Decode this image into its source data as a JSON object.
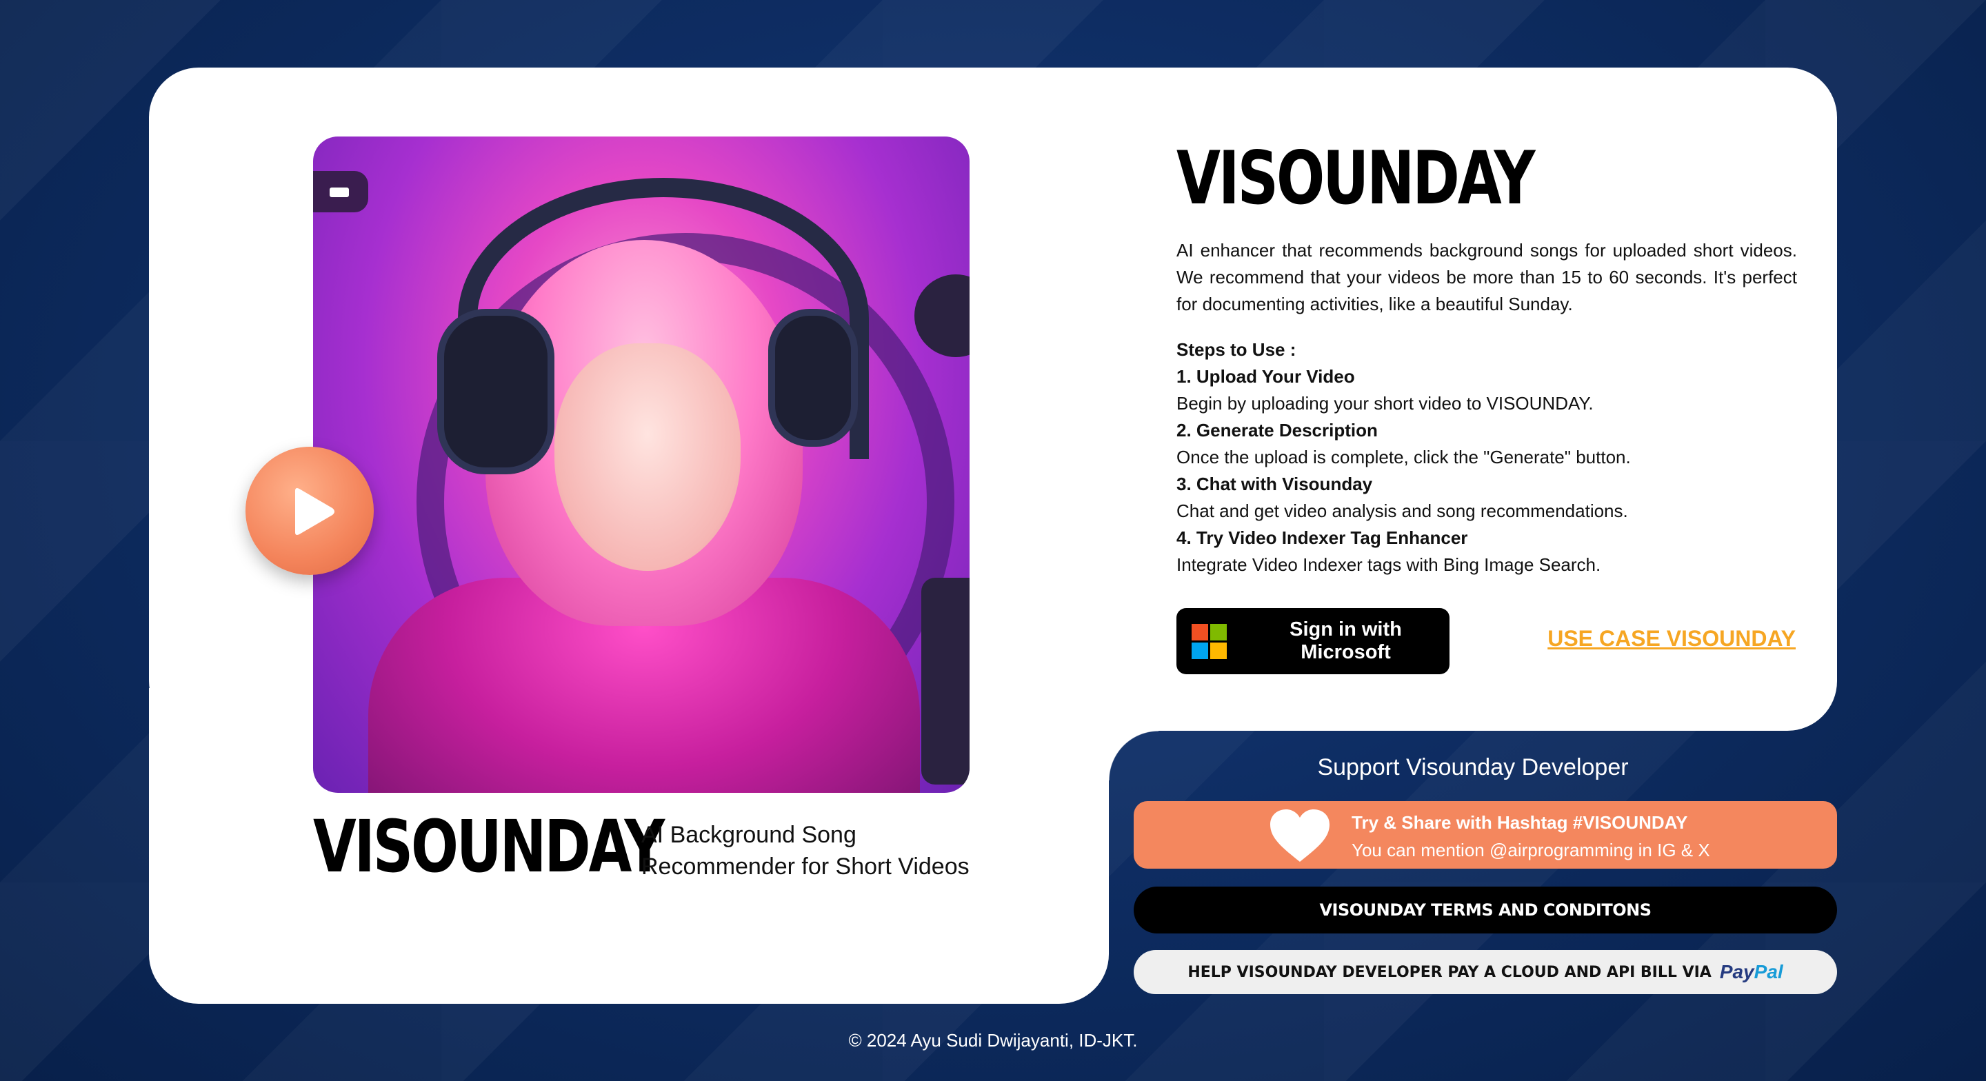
{
  "brand": {
    "name": "VISOUNDAY",
    "tagline_line1": "AI Background Song",
    "tagline_line2": "Recommender for Short Videos"
  },
  "intro": {
    "title": "VISOUNDAY",
    "description": "AI enhancer that recommends background songs for uploaded short videos. We recommend that your videos be more than 15 to 60 seconds. It's perfect for documenting activities, like a beautiful Sunday."
  },
  "steps": {
    "heading": "Steps to Use :",
    "items": [
      {
        "title": "1. Upload Your Video",
        "text": "Begin by uploading your short video to VISOUNDAY."
      },
      {
        "title": "2. Generate Description",
        "text": "Once the upload is complete, click the \"Generate\" button."
      },
      {
        "title": "3. Chat with Visounday",
        "text": "Chat and get video analysis and song recommendations."
      },
      {
        "title": "4. Try Video Indexer Tag Enhancer",
        "text": "Integrate Video Indexer tags with Bing Image Search."
      }
    ]
  },
  "actions": {
    "signin_label": "Sign in with Microsoft",
    "usecase_label": "USE CASE VISOUNDAY"
  },
  "support": {
    "title": "Support Visounday Developer",
    "hashtag_line1": "Try & Share with Hashtag #VISOUNDAY",
    "hashtag_line2": "You can mention @airprogramming in IG & X",
    "terms_label": "VISOUNDAY TERMS AND CONDITONS",
    "paypal_label": "HELP VISOUNDAY DEVELOPER PAY A CLOUD AND API BILL VIA",
    "paypal_brand_1": "Pay",
    "paypal_brand_2": "Pal"
  },
  "footer": {
    "copyright": "© 2024 Ayu Sudi Dwijayanti, ID-JKT."
  },
  "icons": {
    "play": "play-icon",
    "microsoft": "microsoft-logo-icon",
    "heart": "heart-icon"
  },
  "colors": {
    "background": "#0d2a5c",
    "accent_orange": "#f4875e",
    "usecase_link": "#f6a623",
    "card": "#ffffff"
  }
}
